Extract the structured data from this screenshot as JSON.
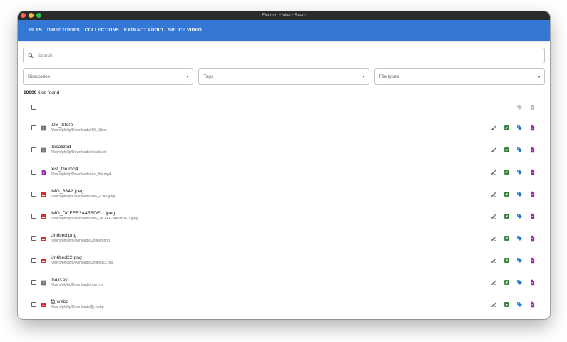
{
  "window": {
    "title": "Electron + Vite + React"
  },
  "nav": {
    "tabs": [
      "FILES",
      "DIRECTORIES",
      "COLLECTIONS",
      "EXTRACT AUDIO",
      "SPLICE VIDEO"
    ]
  },
  "search": {
    "placeholder": "Search",
    "value": ""
  },
  "filters": {
    "directories": "Directories",
    "tags": "Tags",
    "file_types": "File types"
  },
  "results": {
    "count": "10000",
    "suffix": " files found"
  },
  "colors": {
    "appbar": "#3577d4",
    "edit_green": "#2e7d32",
    "tag_blue": "#1976d2",
    "file_purple": "#9c27b0",
    "image_red": "#d32f2f",
    "unknown_gray": "#757575"
  },
  "files": [
    {
      "name": ".DS_Store",
      "path": "/Users/phillip/Downloads/.DS_Store",
      "type": "unknown"
    },
    {
      "name": ".localized",
      "path": "/Users/phillip/Downloads/.localized",
      "type": "unknown"
    },
    {
      "name": "test_file.mp4",
      "path": "/Users/phillip/Downloads/test_file.mp4",
      "type": "video"
    },
    {
      "name": "IMG_6342.jpeg",
      "path": "/Users/phillip/Downloads/IMG_6342.jpeg",
      "type": "image"
    },
    {
      "name": "IMG_DCFEE3A45BDE-1.jpeg",
      "path": "/Users/phillip/Downloads/IMG_DCFEE3A45BDE-1.jpeg",
      "type": "image"
    },
    {
      "name": "Untitled.png",
      "path": "/Users/phillip/Downloads/Untitled.png",
      "type": "image"
    },
    {
      "name": "Untitled22.png",
      "path": "/Users/phillip/Downloads/Untitled22.png",
      "type": "image"
    },
    {
      "name": "main.py",
      "path": "/Users/phillip/Downloads/main.py",
      "type": "unknown"
    },
    {
      "name": "鱼.webp",
      "path": "/Users/phillip/Downloads/鱼.webp",
      "type": "image"
    }
  ]
}
